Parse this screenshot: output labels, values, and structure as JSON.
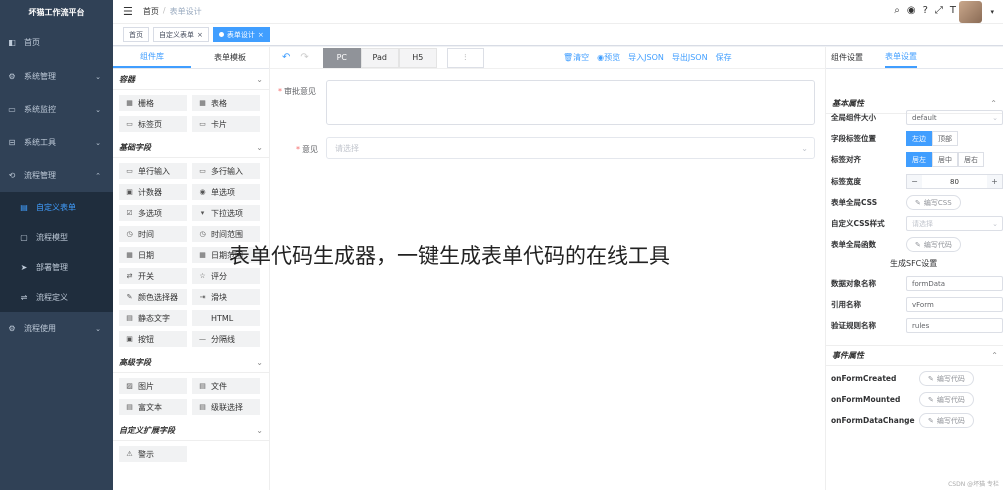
{
  "sidebar": {
    "brand": "坏猫工作流平台",
    "items": [
      {
        "label": "首页",
        "icon": "dashboard-icon",
        "arrow": ""
      },
      {
        "label": "系统管理",
        "icon": "gear-icon",
        "arrow": "⌄"
      },
      {
        "label": "系统监控",
        "icon": "monitor-icon",
        "arrow": "⌄"
      },
      {
        "label": "系统工具",
        "icon": "tool-icon",
        "arrow": "⌄"
      },
      {
        "label": "流程管理",
        "icon": "flow-icon",
        "arrow": "⌃"
      }
    ],
    "sub_items": [
      {
        "label": "自定义表单",
        "icon": "form-icon"
      },
      {
        "label": "流程模型",
        "icon": "model-icon"
      },
      {
        "label": "部署管理",
        "icon": "deploy-icon"
      },
      {
        "label": "流程定义",
        "icon": "definition-icon"
      }
    ],
    "last_item": {
      "label": "流程使用",
      "icon": "gear-icon",
      "arrow": "⌄"
    }
  },
  "topbar": {
    "breadcrumb": [
      "首页",
      "表单设计"
    ],
    "icons": [
      "search-icon",
      "github-icon",
      "help-icon",
      "fullscreen-icon",
      "font-size-icon"
    ]
  },
  "tags": [
    {
      "label": "首页"
    },
    {
      "label": "自定义表单"
    },
    {
      "label": "表单设计"
    }
  ],
  "left_panel": {
    "tabs": [
      "组件库",
      "表单模板"
    ],
    "groups": [
      {
        "title": "容器",
        "widgets": [
          {
            "label": "栅格",
            "icon": "grid-icon"
          },
          {
            "label": "表格",
            "icon": "table-icon"
          },
          {
            "label": "标签页",
            "icon": "tabs-icon"
          },
          {
            "label": "卡片",
            "icon": "card-icon"
          }
        ]
      },
      {
        "title": "基础字段",
        "widgets": [
          {
            "label": "单行输入",
            "icon": "input-icon"
          },
          {
            "label": "多行输入",
            "icon": "textarea-icon"
          },
          {
            "label": "计数器",
            "icon": "counter-icon"
          },
          {
            "label": "单选项",
            "icon": "radio-icon"
          },
          {
            "label": "多选项",
            "icon": "checkbox-icon"
          },
          {
            "label": "下拉选项",
            "icon": "select-icon"
          },
          {
            "label": "时间",
            "icon": "time-icon"
          },
          {
            "label": "时间范围",
            "icon": "time-range-icon"
          },
          {
            "label": "日期",
            "icon": "date-icon"
          },
          {
            "label": "日期范围",
            "icon": "date-range-icon"
          },
          {
            "label": "开关",
            "icon": "switch-icon"
          },
          {
            "label": "评分",
            "icon": "star-icon"
          },
          {
            "label": "颜色选择器",
            "icon": "color-picker-icon"
          },
          {
            "label": "滑块",
            "icon": "slider-icon"
          },
          {
            "label": "静态文字",
            "icon": "text-icon"
          },
          {
            "label": "HTML",
            "icon": "html-icon"
          },
          {
            "label": "按钮",
            "icon": "button-icon"
          },
          {
            "label": "分隔线",
            "icon": "divider-icon"
          }
        ]
      },
      {
        "title": "高级字段",
        "widgets": [
          {
            "label": "图片",
            "icon": "image-icon"
          },
          {
            "label": "文件",
            "icon": "file-icon"
          },
          {
            "label": "富文本",
            "icon": "rich-text-icon"
          },
          {
            "label": "级联选择",
            "icon": "cascader-icon"
          }
        ]
      },
      {
        "title": "自定义扩展字段",
        "widgets": [
          {
            "label": "警示",
            "icon": "alert-icon"
          }
        ]
      }
    ]
  },
  "center": {
    "devices": [
      "PC",
      "Pad",
      "H5"
    ],
    "active_device": "PC",
    "actions": [
      "清空",
      "预览",
      "导入JSON",
      "导出JSON",
      "保存"
    ],
    "fields": [
      {
        "label": "审批意见",
        "required": true,
        "type": "textarea"
      },
      {
        "label": "意见",
        "required": true,
        "type": "select",
        "placeholder": "请选择"
      }
    ]
  },
  "right_panel": {
    "tabs": [
      "组件设置",
      "表单设置"
    ],
    "sections": {
      "basic": "基本属性",
      "event": "事件属性"
    },
    "props": {
      "size_label": "全局组件大小",
      "size_value": "default",
      "label_pos_label": "字段标签位置",
      "label_pos_options": [
        "左边",
        "顶部"
      ],
      "label_align_label": "标签对齐",
      "label_align_options": [
        "居左",
        "居中",
        "居右"
      ],
      "label_width_label": "标签宽度",
      "label_width_value": "80",
      "css_label": "表单全局CSS",
      "css_btn": "编写CSS",
      "custom_css_label": "自定义CSS样式",
      "custom_css_placeholder": "请选择",
      "func_label": "表单全局函数",
      "func_btn": "编写代码",
      "sfc_label": "生成SFC设置",
      "model_label": "数据对象名称",
      "model_value": "formData",
      "ref_label": "引用名称",
      "ref_value": "vForm",
      "rules_label": "验证规则名称",
      "rules_value": "rules"
    },
    "events": [
      {
        "label": "onFormCreated",
        "btn": "编写代码"
      },
      {
        "label": "onFormMounted",
        "btn": "编写代码"
      },
      {
        "label": "onFormDataChange",
        "btn": "编写代码"
      }
    ]
  },
  "overlay_caption": "表单代码生成器，一键生成表单代码的在线工具",
  "footer_text": "CSDN @坏猫 专栏"
}
